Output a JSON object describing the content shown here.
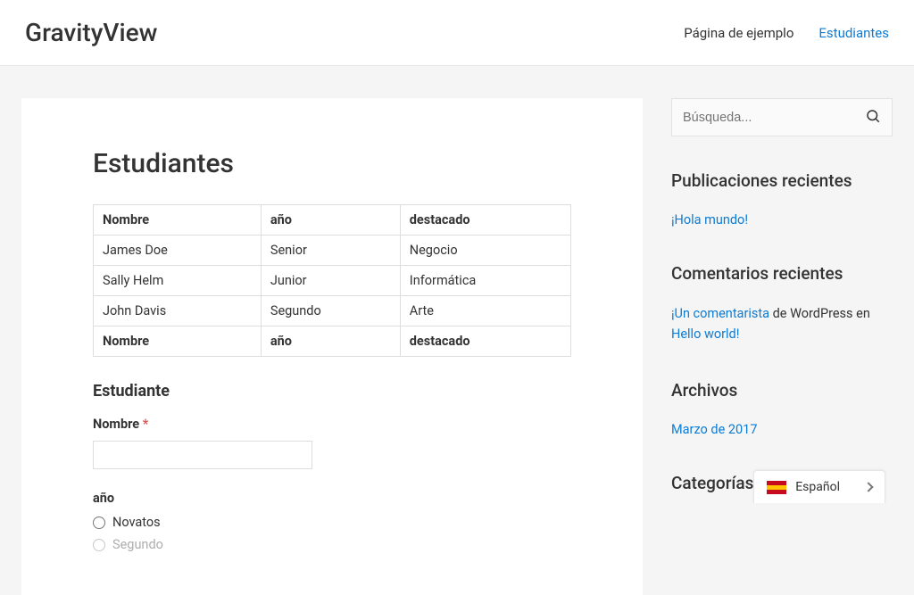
{
  "header": {
    "site_title": "GravityView",
    "nav": [
      {
        "label": "Página de ejemplo",
        "active": false
      },
      {
        "label": "Estudiantes",
        "active": true
      }
    ]
  },
  "main": {
    "title": "Estudiantes",
    "table": {
      "headers": [
        "Nombre",
        "año",
        "destacado"
      ],
      "rows": [
        [
          "James Doe",
          "Senior",
          "Negocio"
        ],
        [
          "Sally Helm",
          "Junior",
          "Informática"
        ],
        [
          "John Davis",
          "Segundo",
          "Arte"
        ]
      ],
      "footers": [
        "Nombre",
        "año",
        "destacado"
      ]
    },
    "form": {
      "title": "Estudiante",
      "name_label": "Nombre",
      "required_mark": "*",
      "year_label": "año",
      "year_options": [
        "Novatos",
        "Segundo"
      ]
    }
  },
  "sidebar": {
    "search_placeholder": "Búsqueda...",
    "recent_posts": {
      "title": "Publicaciones recientes",
      "items": [
        "¡Hola mundo!"
      ]
    },
    "recent_comments": {
      "title": "Comentarios recientes",
      "prefix": "",
      "author": "¡Un comentarista",
      "middle": " de WordPress en ",
      "post": "Hello world!"
    },
    "archives": {
      "title": "Archivos",
      "items": [
        "Marzo de 2017"
      ]
    },
    "categories": {
      "title": "Categorías"
    }
  },
  "lang": {
    "name": "Español"
  }
}
